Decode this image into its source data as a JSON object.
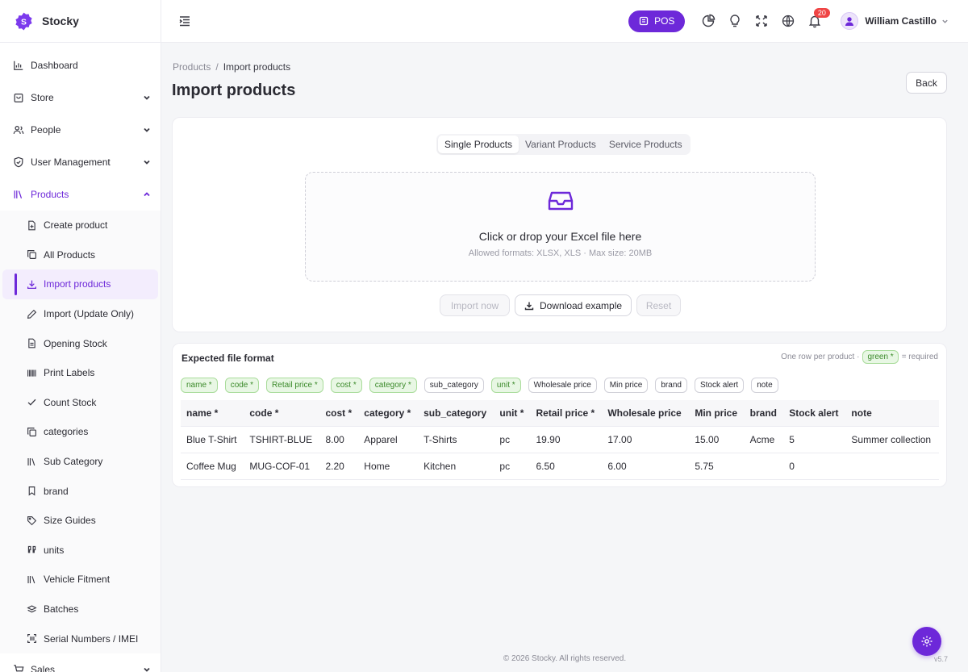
{
  "app": {
    "name": "Stocky"
  },
  "sidebar": {
    "items": [
      {
        "label": "Dashboard",
        "icon": "chart-bar-icon"
      },
      {
        "label": "Store",
        "icon": "store-icon"
      },
      {
        "label": "People",
        "icon": "people-icon"
      },
      {
        "label": "User Management",
        "icon": "shield-icon"
      },
      {
        "label": "Products",
        "icon": "books-icon"
      },
      {
        "label": "Sales",
        "icon": "cart-icon"
      }
    ],
    "products_sub": [
      {
        "label": "Create product",
        "icon": "file-plus-icon"
      },
      {
        "label": "All Products",
        "icon": "copy-icon"
      },
      {
        "label": "Import products",
        "icon": "download-icon"
      },
      {
        "label": "Import (Update Only)",
        "icon": "pencil-icon"
      },
      {
        "label": "Opening Stock",
        "icon": "file-list-icon"
      },
      {
        "label": "Print Labels",
        "icon": "barcode-icon"
      },
      {
        "label": "Count Stock",
        "icon": "check-icon"
      },
      {
        "label": "categories",
        "icon": "copy-icon"
      },
      {
        "label": "Sub Category",
        "icon": "books-icon"
      },
      {
        "label": "brand",
        "icon": "bookmark-icon"
      },
      {
        "label": "Size Guides",
        "icon": "tag-icon"
      },
      {
        "label": "units",
        "icon": "quote-icon"
      },
      {
        "label": "Vehicle Fitment",
        "icon": "books-icon"
      },
      {
        "label": "Batches",
        "icon": "layers-icon"
      },
      {
        "label": "Serial Numbers / IMEI",
        "icon": "scan-icon"
      }
    ]
  },
  "topbar": {
    "pos_label": "POS",
    "notification_count": "20",
    "user_name": "William Castillo"
  },
  "breadcrumb": {
    "parent": "Products",
    "separator": "/",
    "current": "Import products"
  },
  "page": {
    "title": "Import products",
    "back_label": "Back"
  },
  "upload": {
    "tabs": [
      "Single Products",
      "Variant Products",
      "Service Products"
    ],
    "active_tab": "Single Products",
    "dropzone_title": "Click or drop your Excel file here",
    "dropzone_sub": "Allowed formats: XLSX, XLS · Max size: 20MB",
    "import_label": "Import now",
    "download_label": "Download example",
    "reset_label": "Reset"
  },
  "format": {
    "title": "Expected file format",
    "note_prefix": "One row per product ·",
    "note_tag": "green *",
    "note_suffix": "= required",
    "chips": [
      {
        "label": "name *",
        "required": true
      },
      {
        "label": "code *",
        "required": true
      },
      {
        "label": "Retail price *",
        "required": true
      },
      {
        "label": "cost *",
        "required": true
      },
      {
        "label": "category *",
        "required": true
      },
      {
        "label": "sub_category",
        "required": false
      },
      {
        "label": "unit *",
        "required": true
      },
      {
        "label": "Wholesale price",
        "required": false
      },
      {
        "label": "Min price",
        "required": false
      },
      {
        "label": "brand",
        "required": false
      },
      {
        "label": "Stock alert",
        "required": false
      },
      {
        "label": "note",
        "required": false
      }
    ],
    "columns": [
      "name *",
      "code *",
      "cost *",
      "category *",
      "sub_category",
      "unit *",
      "Retail price *",
      "Wholesale price",
      "Min price",
      "brand",
      "Stock alert",
      "note"
    ],
    "rows": [
      [
        "Blue T-Shirt",
        "TSHIRT-BLUE",
        "8.00",
        "Apparel",
        "T-Shirts",
        "pc",
        "19.90",
        "17.00",
        "15.00",
        "Acme",
        "5",
        "Summer collection"
      ],
      [
        "Coffee Mug",
        "MUG-COF-01",
        "2.20",
        "Home",
        "Kitchen",
        "pc",
        "6.50",
        "6.00",
        "5.75",
        "",
        "0",
        ""
      ]
    ]
  },
  "footer": {
    "copyright": "© 2026 Stocky. All rights reserved.",
    "version": "v5.7"
  },
  "colors": {
    "accent": "#6d28d9",
    "required_bg": "#e8f7e4",
    "required_text": "#3b8a2a",
    "badge": "#ef4444"
  }
}
